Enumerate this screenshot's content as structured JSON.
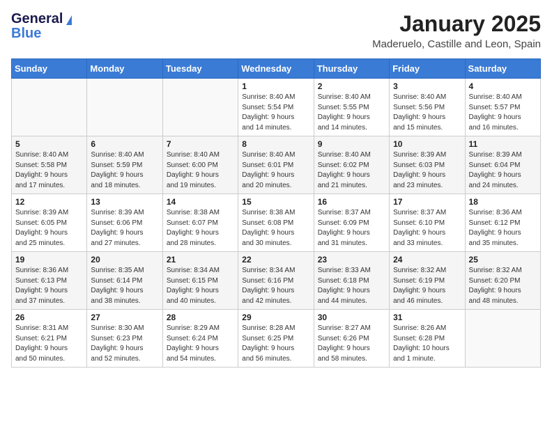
{
  "logo": {
    "line1": "General",
    "line2": "Blue"
  },
  "header": {
    "month": "January 2025",
    "location": "Maderuelo, Castille and Leon, Spain"
  },
  "weekdays": [
    "Sunday",
    "Monday",
    "Tuesday",
    "Wednesday",
    "Thursday",
    "Friday",
    "Saturday"
  ],
  "weeks": [
    [
      {
        "day": "",
        "info": ""
      },
      {
        "day": "",
        "info": ""
      },
      {
        "day": "",
        "info": ""
      },
      {
        "day": "1",
        "info": "Sunrise: 8:40 AM\nSunset: 5:54 PM\nDaylight: 9 hours\nand 14 minutes."
      },
      {
        "day": "2",
        "info": "Sunrise: 8:40 AM\nSunset: 5:55 PM\nDaylight: 9 hours\nand 14 minutes."
      },
      {
        "day": "3",
        "info": "Sunrise: 8:40 AM\nSunset: 5:56 PM\nDaylight: 9 hours\nand 15 minutes."
      },
      {
        "day": "4",
        "info": "Sunrise: 8:40 AM\nSunset: 5:57 PM\nDaylight: 9 hours\nand 16 minutes."
      }
    ],
    [
      {
        "day": "5",
        "info": "Sunrise: 8:40 AM\nSunset: 5:58 PM\nDaylight: 9 hours\nand 17 minutes."
      },
      {
        "day": "6",
        "info": "Sunrise: 8:40 AM\nSunset: 5:59 PM\nDaylight: 9 hours\nand 18 minutes."
      },
      {
        "day": "7",
        "info": "Sunrise: 8:40 AM\nSunset: 6:00 PM\nDaylight: 9 hours\nand 19 minutes."
      },
      {
        "day": "8",
        "info": "Sunrise: 8:40 AM\nSunset: 6:01 PM\nDaylight: 9 hours\nand 20 minutes."
      },
      {
        "day": "9",
        "info": "Sunrise: 8:40 AM\nSunset: 6:02 PM\nDaylight: 9 hours\nand 21 minutes."
      },
      {
        "day": "10",
        "info": "Sunrise: 8:39 AM\nSunset: 6:03 PM\nDaylight: 9 hours\nand 23 minutes."
      },
      {
        "day": "11",
        "info": "Sunrise: 8:39 AM\nSunset: 6:04 PM\nDaylight: 9 hours\nand 24 minutes."
      }
    ],
    [
      {
        "day": "12",
        "info": "Sunrise: 8:39 AM\nSunset: 6:05 PM\nDaylight: 9 hours\nand 25 minutes."
      },
      {
        "day": "13",
        "info": "Sunrise: 8:39 AM\nSunset: 6:06 PM\nDaylight: 9 hours\nand 27 minutes."
      },
      {
        "day": "14",
        "info": "Sunrise: 8:38 AM\nSunset: 6:07 PM\nDaylight: 9 hours\nand 28 minutes."
      },
      {
        "day": "15",
        "info": "Sunrise: 8:38 AM\nSunset: 6:08 PM\nDaylight: 9 hours\nand 30 minutes."
      },
      {
        "day": "16",
        "info": "Sunrise: 8:37 AM\nSunset: 6:09 PM\nDaylight: 9 hours\nand 31 minutes."
      },
      {
        "day": "17",
        "info": "Sunrise: 8:37 AM\nSunset: 6:10 PM\nDaylight: 9 hours\nand 33 minutes."
      },
      {
        "day": "18",
        "info": "Sunrise: 8:36 AM\nSunset: 6:12 PM\nDaylight: 9 hours\nand 35 minutes."
      }
    ],
    [
      {
        "day": "19",
        "info": "Sunrise: 8:36 AM\nSunset: 6:13 PM\nDaylight: 9 hours\nand 37 minutes."
      },
      {
        "day": "20",
        "info": "Sunrise: 8:35 AM\nSunset: 6:14 PM\nDaylight: 9 hours\nand 38 minutes."
      },
      {
        "day": "21",
        "info": "Sunrise: 8:34 AM\nSunset: 6:15 PM\nDaylight: 9 hours\nand 40 minutes."
      },
      {
        "day": "22",
        "info": "Sunrise: 8:34 AM\nSunset: 6:16 PM\nDaylight: 9 hours\nand 42 minutes."
      },
      {
        "day": "23",
        "info": "Sunrise: 8:33 AM\nSunset: 6:18 PM\nDaylight: 9 hours\nand 44 minutes."
      },
      {
        "day": "24",
        "info": "Sunrise: 8:32 AM\nSunset: 6:19 PM\nDaylight: 9 hours\nand 46 minutes."
      },
      {
        "day": "25",
        "info": "Sunrise: 8:32 AM\nSunset: 6:20 PM\nDaylight: 9 hours\nand 48 minutes."
      }
    ],
    [
      {
        "day": "26",
        "info": "Sunrise: 8:31 AM\nSunset: 6:21 PM\nDaylight: 9 hours\nand 50 minutes."
      },
      {
        "day": "27",
        "info": "Sunrise: 8:30 AM\nSunset: 6:23 PM\nDaylight: 9 hours\nand 52 minutes."
      },
      {
        "day": "28",
        "info": "Sunrise: 8:29 AM\nSunset: 6:24 PM\nDaylight: 9 hours\nand 54 minutes."
      },
      {
        "day": "29",
        "info": "Sunrise: 8:28 AM\nSunset: 6:25 PM\nDaylight: 9 hours\nand 56 minutes."
      },
      {
        "day": "30",
        "info": "Sunrise: 8:27 AM\nSunset: 6:26 PM\nDaylight: 9 hours\nand 58 minutes."
      },
      {
        "day": "31",
        "info": "Sunrise: 8:26 AM\nSunset: 6:28 PM\nDaylight: 10 hours\nand 1 minute."
      },
      {
        "day": "",
        "info": ""
      }
    ]
  ]
}
